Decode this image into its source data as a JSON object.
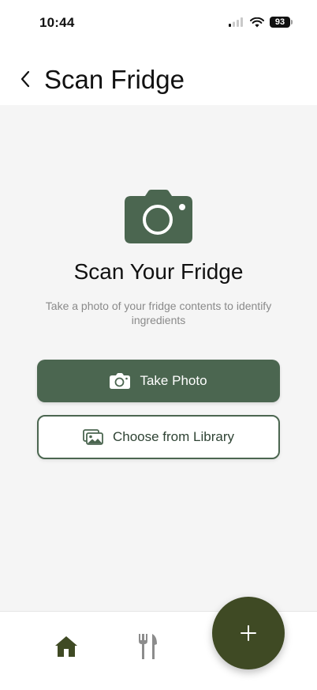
{
  "status_bar": {
    "time": "10:44",
    "battery": "93"
  },
  "header": {
    "title": "Scan Fridge"
  },
  "main": {
    "heading": "Scan Your Fridge",
    "subtitle": "Take a photo of your fridge contents to identify ingredients",
    "take_photo_label": "Take Photo",
    "library_label": "Choose from Library"
  },
  "icons": {
    "back": "chevron-left-icon",
    "camera": "camera-icon",
    "library": "photo-library-icon",
    "home": "home-icon",
    "recipes": "fork-knife-icon",
    "add": "plus-icon"
  },
  "colors": {
    "primary": "#4b6650",
    "fab": "#3f4a24",
    "background": "#f5f5f5"
  }
}
